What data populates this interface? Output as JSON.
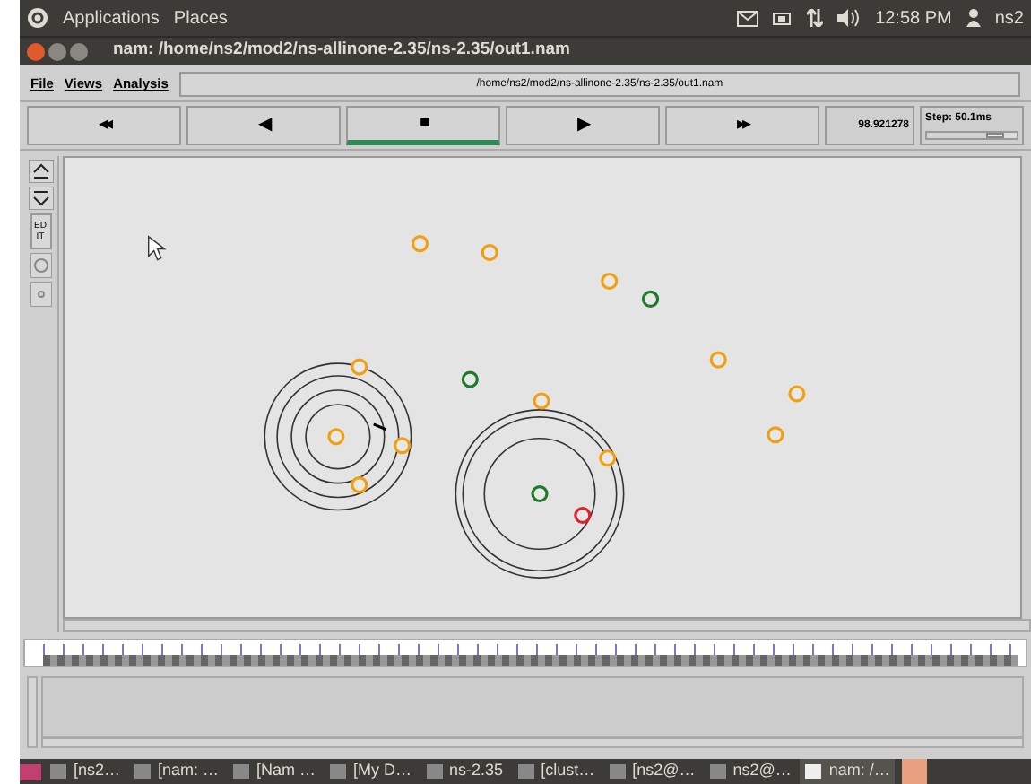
{
  "top_panel": {
    "menus": [
      "Applications",
      "Places"
    ],
    "clock": "12:58 PM",
    "user": "ns2"
  },
  "window": {
    "title": "nam: /home/ns2/mod2/ns-allinone-2.35/ns-2.35/out1.nam"
  },
  "menu": [
    "File",
    "Views",
    "Analysis"
  ],
  "file_path": "/home/ns2/mod2/ns-allinone-2.35/ns-2.35/out1.nam",
  "controls": [
    {
      "glyph": "◂◂",
      "selected": false
    },
    {
      "glyph": "◀",
      "selected": false
    },
    {
      "glyph": "■",
      "selected": true
    },
    {
      "glyph": "▶",
      "selected": false
    },
    {
      "glyph": "▸▸",
      "selected": false
    }
  ],
  "time": "98.921278",
  "step": {
    "label": "Step: 50.1ms",
    "level": 0.85
  },
  "tools": [
    "EDIT"
  ],
  "nodes": [
    {
      "color": "#f0a010"
    },
    {
      "color": "#f0a010"
    },
    {
      "color": "#f0a010"
    },
    {
      "color": "#1f7a2a"
    },
    {
      "color": "#f0a010"
    },
    {
      "color": "#f0a010"
    },
    {
      "color": "#f0a010"
    },
    {
      "color": "#f0a010"
    },
    {
      "color": "#1f7a2a"
    },
    {
      "color": "#f0a010"
    },
    {
      "color": "#f0a010"
    },
    {
      "color": "#f0a010"
    },
    {
      "color": "#f0a010"
    },
    {
      "color": "#1f7a2a"
    },
    {
      "color": "#e0202a"
    },
    {
      "color": "#f0a010"
    }
  ],
  "taskbar": [
    {
      "label": "[ns2…",
      "selected": false
    },
    {
      "label": "[nam: …",
      "selected": false
    },
    {
      "label": "[Nam …",
      "selected": false
    },
    {
      "label": "[My D…",
      "selected": false
    },
    {
      "label": "ns-2.35",
      "selected": false
    },
    {
      "label": "[clust…",
      "selected": false
    },
    {
      "label": "[ns2@…",
      "selected": false
    },
    {
      "label": "ns2@…",
      "selected": false
    },
    {
      "label": "nam: /…",
      "selected": true
    }
  ]
}
